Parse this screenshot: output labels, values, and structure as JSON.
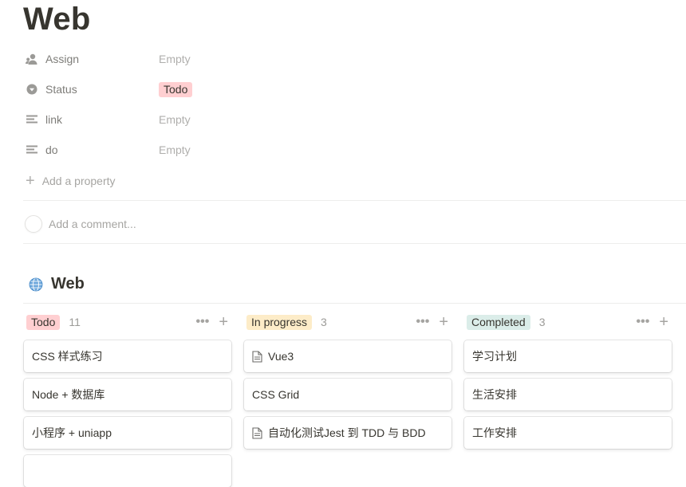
{
  "page": {
    "title": "Web"
  },
  "properties": [
    {
      "icon": "person-icon",
      "name": "Assign",
      "value": "Empty"
    },
    {
      "icon": "status-icon",
      "name": "Status",
      "value": "Todo",
      "tag_color": "#ffcfd1"
    },
    {
      "icon": "text-lines-icon",
      "name": "link",
      "value": "Empty"
    },
    {
      "icon": "text-lines-icon",
      "name": "do",
      "value": "Empty"
    }
  ],
  "add_property_label": "Add a property",
  "comment_placeholder": "Add a comment...",
  "database": {
    "icon": "globe-icon",
    "title": "Web",
    "columns": [
      {
        "label": "Todo",
        "count": "11",
        "color": "#ffcfd1",
        "cards": [
          {
            "title": "CSS 样式练习",
            "doc": false
          },
          {
            "title": "Node + 数据库",
            "doc": false
          },
          {
            "title": "小程序 + uniapp",
            "doc": false
          }
        ]
      },
      {
        "label": "In progress",
        "count": "3",
        "color": "#fdecc8",
        "cards": [
          {
            "title": "Vue3",
            "doc": true
          },
          {
            "title": "CSS Grid",
            "doc": false
          },
          {
            "title": "自动化测试Jest 到 TDD 与 BDD",
            "doc": true
          }
        ]
      },
      {
        "label": "Completed",
        "count": "3",
        "color": "#dbede9",
        "cards": [
          {
            "title": "学习计划",
            "doc": false
          },
          {
            "title": "生活安排",
            "doc": false
          },
          {
            "title": "工作安排",
            "doc": false
          }
        ]
      }
    ]
  }
}
